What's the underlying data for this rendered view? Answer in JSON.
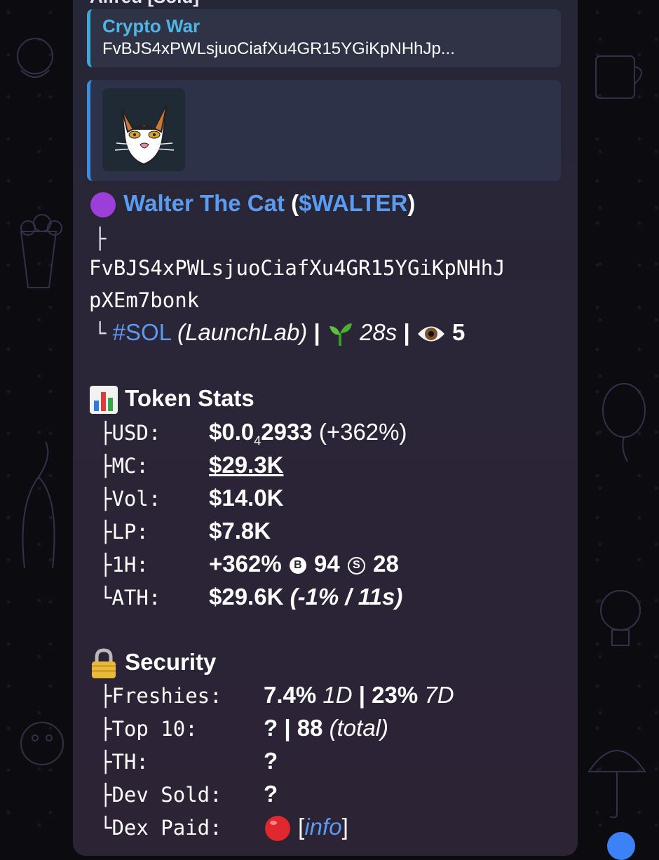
{
  "partial_header": "Alfred [Sold]",
  "reply": {
    "title": "Crypto War",
    "text": "FvBJS4xPWLsjuoCiafXu4GR15YGiKpNHhJp..."
  },
  "token": {
    "name": "Walter The Cat",
    "symbol": "$WALTER",
    "address_line1": "FvBJS4xPWLsjuoCiafXu4GR15YGiKpNHhJ",
    "address_line2": "pXEm7bonk",
    "chain_tag": "#SOL",
    "platform": "(LaunchLab)",
    "age": "28s",
    "views": "5"
  },
  "stats": {
    "header": "Token Stats",
    "usd_label": "USD:",
    "usd_value_main": "$0.0",
    "usd_value_sub": "4",
    "usd_value_tail": "2933",
    "usd_change": "(+362%)",
    "mc_label": "MC:",
    "mc_value": "$29.3K",
    "vol_label": "Vol:",
    "vol_value": "$14.0K",
    "lp_label": "LP:",
    "lp_value": "$7.8K",
    "h1_label": "1H:",
    "h1_change": "+362%",
    "h1_buys": "94",
    "h1_sells": "28",
    "ath_label": "ATH:",
    "ath_value": "$29.6K",
    "ath_detail": "(-1% / 11s)"
  },
  "security": {
    "header": "Security",
    "freshies_label": "Freshies:",
    "freshies_1d": "7.4%",
    "freshies_1d_unit": "1D",
    "freshies_7d": "23%",
    "freshies_7d_unit": "7D",
    "top10_label": "Top 10:",
    "top10_value": "?",
    "top10_total": "88",
    "top10_total_label": "(total)",
    "th_label": "TH:",
    "th_value": "?",
    "dev_label": "Dev Sold:",
    "dev_value": "?",
    "dex_label": "Dex Paid:",
    "dex_link": "info"
  },
  "icons": {
    "status": "purple-circle",
    "age": "seedling",
    "views": "eye",
    "stats": "bar-chart",
    "security": "lock",
    "dex_paid": "red-circle"
  },
  "colors": {
    "accent_blue": "#5b9bf0",
    "reply_bar": "#3ca9d8",
    "bubble": "#2a2537"
  }
}
